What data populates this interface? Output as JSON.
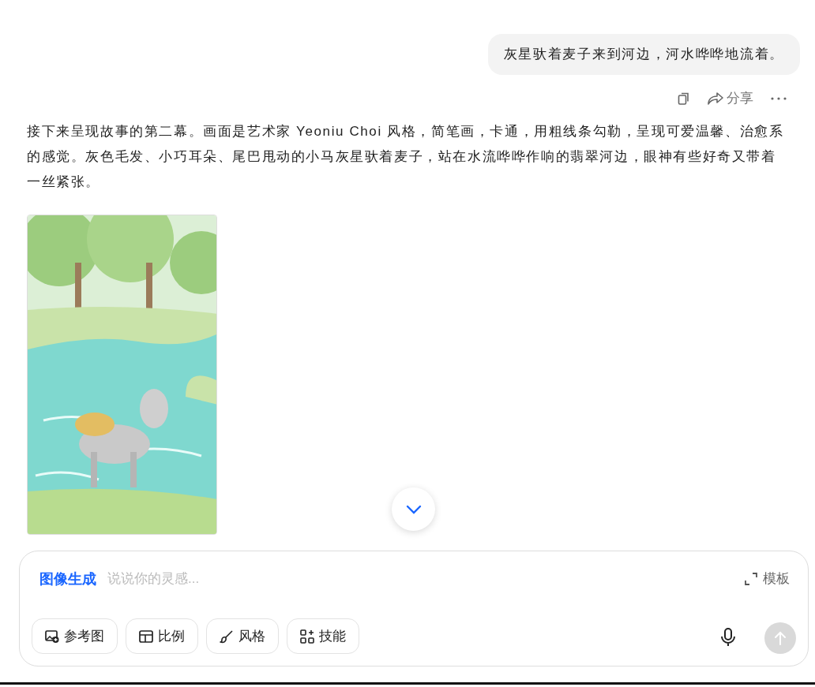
{
  "user_message": {
    "text": "灰星驮着麦子来到河边，河水哗哗地流着。"
  },
  "message_actions": [
    {
      "kind": "copy"
    },
    {
      "kind": "share",
      "label": "分享"
    },
    {
      "kind": "more"
    }
  ],
  "reply": {
    "text": "接下来呈现故事的第二幕。画面是艺术家 Yeoniu Choi 风格，简笔画，卡通，用粗线条勾勒，呈现可爱温馨、治愈系的感觉。灰色毛发、小巧耳朵、尾巴甩动的小马灰星驮着麦子，站在水流哗哗作响的翡翠河边，眼神有些好奇又带着一丝紧张。"
  },
  "composer": {
    "mode": "图像生成",
    "placeholder": "说说你的灵感...",
    "template": "模板",
    "tools": [
      {
        "kind": "reference",
        "label": "参考图"
      },
      {
        "kind": "ratio",
        "label": "比例"
      },
      {
        "kind": "style",
        "label": "风格"
      },
      {
        "kind": "skill",
        "label": "技能"
      }
    ],
    "send_disabled": true
  }
}
